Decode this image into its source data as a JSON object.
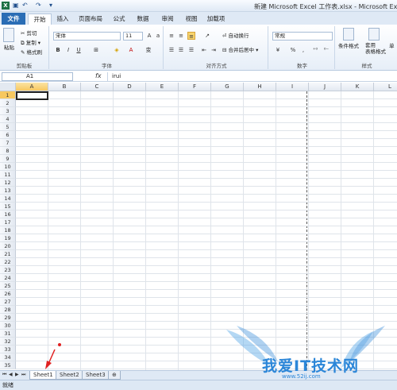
{
  "window": {
    "title": "新建 Microsoft Excel 工作表.xlsx - Microsoft Excel",
    "app_icon": "X",
    "quick_access": [
      "save-icon",
      "undo-icon",
      "redo-icon",
      "customize-icon"
    ]
  },
  "ribbon": {
    "tabs": [
      "文件",
      "开始",
      "插入",
      "页面布局",
      "公式",
      "数据",
      "审阅",
      "视图",
      "加载项"
    ],
    "active_tab": "开始",
    "clipboard": {
      "paste": "粘贴",
      "cut": "剪切",
      "copy": "复制 ▾",
      "format_painter": "格式刷",
      "label": "剪贴板"
    },
    "font": {
      "name": "宋体",
      "size": "11",
      "label": "字体",
      "bold": "B",
      "italic": "I",
      "underline": "U"
    },
    "alignment": {
      "wrap": "自动换行",
      "merge": "合并后居中 ▾",
      "label": "对齐方式"
    },
    "number": {
      "format": "常规",
      "label": "数字",
      "percent": "%",
      "comma": ","
    },
    "styles": {
      "conditional": "条件格式",
      "table": "套用\n表格格式",
      "cell_style": "单",
      "label": "样式"
    }
  },
  "formula_bar": {
    "name_box": "A1",
    "fx": "fx",
    "content": "irui"
  },
  "grid": {
    "columns": [
      "A",
      "B",
      "C",
      "D",
      "E",
      "F",
      "G",
      "H",
      "I",
      "J",
      "K",
      "L"
    ],
    "rows": [
      "1",
      "2",
      "3",
      "4",
      "5",
      "6",
      "7",
      "8",
      "9",
      "10",
      "11",
      "12",
      "13",
      "14",
      "15",
      "16",
      "17",
      "18",
      "19",
      "20",
      "21",
      "22",
      "23",
      "24",
      "25",
      "26",
      "27",
      "28",
      "29",
      "30",
      "31",
      "32",
      "33",
      "34",
      "35"
    ],
    "selected_cell": "A1"
  },
  "sheets": [
    "Sheet1",
    "Sheet2",
    "Sheet3"
  ],
  "active_sheet": "Sheet1",
  "status": "就绪",
  "watermark": {
    "text": "我爱IT技术网",
    "url": "www.52ij.com"
  },
  "colors": {
    "file_tab": "#2a6db5",
    "selection": "#f7c860",
    "accent": "#1e7145",
    "arrow": "#e02020",
    "watermark": "#2b86d8"
  }
}
